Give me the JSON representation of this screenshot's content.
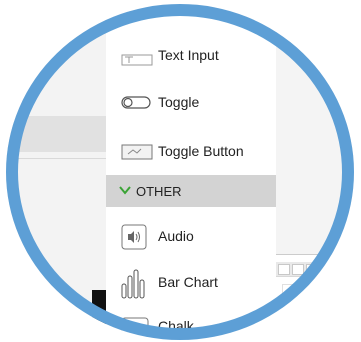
{
  "components": {
    "items": [
      {
        "label": "Text Input",
        "icon": "text-input-icon"
      },
      {
        "label": "Toggle",
        "icon": "toggle-icon"
      },
      {
        "label": "Toggle Button",
        "icon": "toggle-button-icon"
      }
    ],
    "section": {
      "label": "OTHER",
      "icon": "chevron-down-icon"
    },
    "other_items": [
      {
        "label": "Audio",
        "icon": "audio-icon"
      },
      {
        "label": "Bar Chart",
        "icon": "bar-chart-icon"
      },
      {
        "label": "Chalk",
        "icon": "chalk-icon"
      }
    ]
  },
  "colors": {
    "ring": "#5d9fd6",
    "accent_green": "#3aa335",
    "section_bg": "#d3d3d3"
  }
}
